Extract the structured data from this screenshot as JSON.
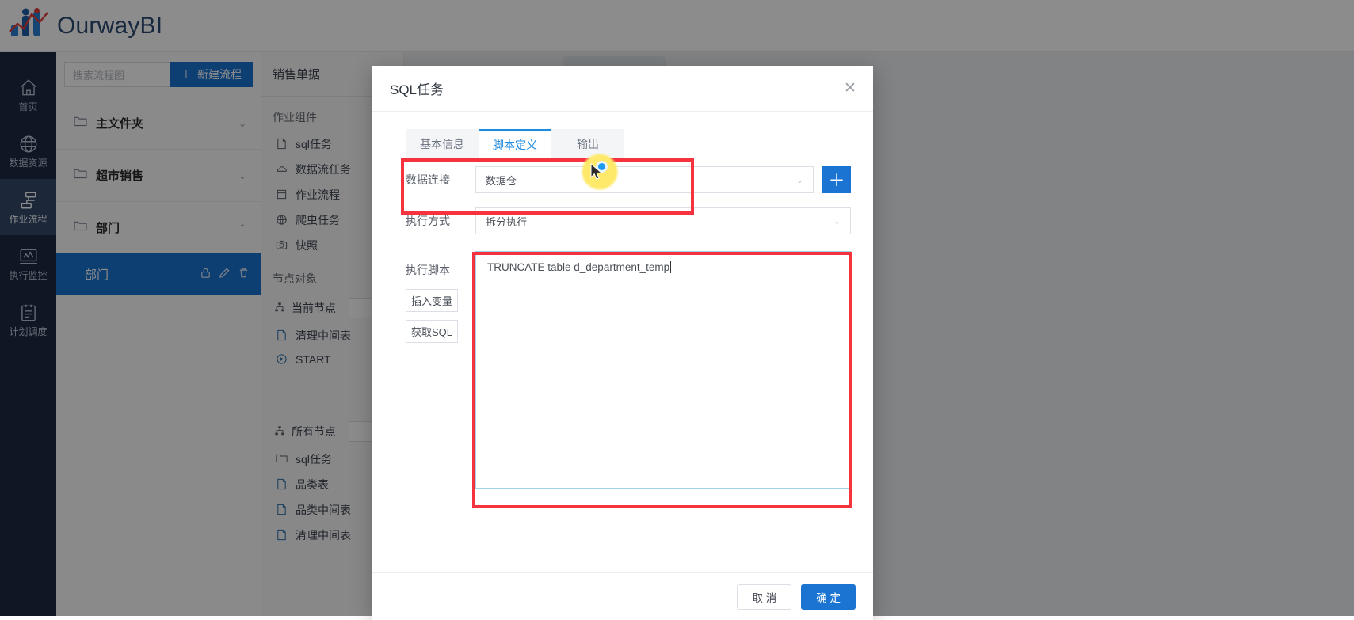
{
  "brand": {
    "name": "OurwayBI"
  },
  "rail": {
    "items": [
      {
        "label": "首页",
        "icon": "home-icon",
        "active": false
      },
      {
        "label": "数据资源",
        "icon": "globe-icon",
        "active": false
      },
      {
        "label": "作业流程",
        "icon": "workflow-icon",
        "active": true
      },
      {
        "label": "执行监控",
        "icon": "monitor-icon",
        "active": false
      },
      {
        "label": "计划调度",
        "icon": "schedule-icon",
        "active": false
      }
    ]
  },
  "flowcol": {
    "search_placeholder": "搜索流程图",
    "new_flow_label": "新建流程",
    "folders": [
      {
        "name": "主文件夹",
        "expanded": false
      },
      {
        "name": "超市销售",
        "expanded": false
      },
      {
        "name": "部门",
        "expanded": true
      }
    ],
    "selected_flow": "部门"
  },
  "palette": {
    "doc_tab": "销售单据",
    "job_components_title": "作业组件",
    "job_components": [
      {
        "label": "sql任务",
        "icon": "sql-file-icon"
      },
      {
        "label": "数据流任务",
        "icon": "cloud-icon"
      },
      {
        "label": "作业流程",
        "icon": "calendar-icon"
      },
      {
        "label": "爬虫任务",
        "icon": "globe-small-icon"
      },
      {
        "label": "快照",
        "icon": "camera-icon"
      }
    ],
    "node_objects_title": "节点对象",
    "current_node_label": "当前节点",
    "current_nodes": [
      {
        "label": "清理中间表",
        "icon": "sql-file-icon"
      },
      {
        "label": "START",
        "icon": "play-circle-icon"
      }
    ],
    "all_nodes_label": "所有节点",
    "all_nodes": [
      {
        "label": "sql任务",
        "icon": "folder-icon"
      },
      {
        "label": "品类表",
        "icon": "sql-file-icon"
      },
      {
        "label": "品类中间表",
        "icon": "sql-file-icon"
      },
      {
        "label": "清理中间表",
        "icon": "sql-file-icon"
      }
    ]
  },
  "modal": {
    "title": "SQL任务",
    "close_icon": "close-icon",
    "tabs": [
      {
        "label": "基本信息",
        "active": false
      },
      {
        "label": "脚本定义",
        "active": true
      },
      {
        "label": "输出",
        "active": false
      }
    ],
    "fields": {
      "connection_label": "数据连接",
      "connection_value": "数据仓",
      "add_connection_icon": "plus-icon",
      "exec_mode_label": "执行方式",
      "exec_mode_value": "拆分执行",
      "script_label": "执行脚本",
      "insert_var_label": "插入变量",
      "get_sql_label": "获取SQL",
      "script_value": "TRUNCATE table d_department_temp"
    },
    "footer": {
      "cancel_label": "取 消",
      "confirm_label": "确 定"
    }
  },
  "annotations": {
    "accent_red": "#f5333f",
    "accent_blue": "#1b74d1",
    "highlight_yellow": "#ffe96b"
  }
}
